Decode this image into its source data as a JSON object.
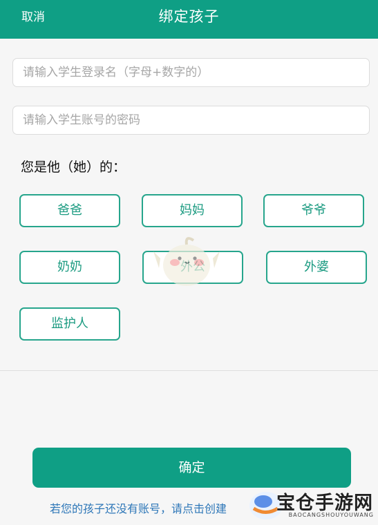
{
  "header": {
    "cancel_label": "取消",
    "title": "绑定孩子"
  },
  "form": {
    "username_placeholder": "请输入学生登录名（字母+数字的）",
    "password_placeholder": "请输入学生账号的密码"
  },
  "relationship": {
    "question": "您是他（她）的：",
    "options": [
      "爸爸",
      "妈妈",
      "爷爷",
      "奶奶",
      "外公",
      "外婆",
      "监护人"
    ]
  },
  "actions": {
    "confirm_label": "确定"
  },
  "footer": {
    "note": "若您的孩子还没有账号，请点击创建"
  },
  "watermark": {
    "brand_name": "宝仓手游网",
    "brand_url": "BAOCANGSHOUYOUWANG"
  },
  "colors": {
    "primary": "#0f9f85",
    "border": "#26a58c",
    "link": "#2e77b8",
    "background": "#f6f6f6"
  }
}
